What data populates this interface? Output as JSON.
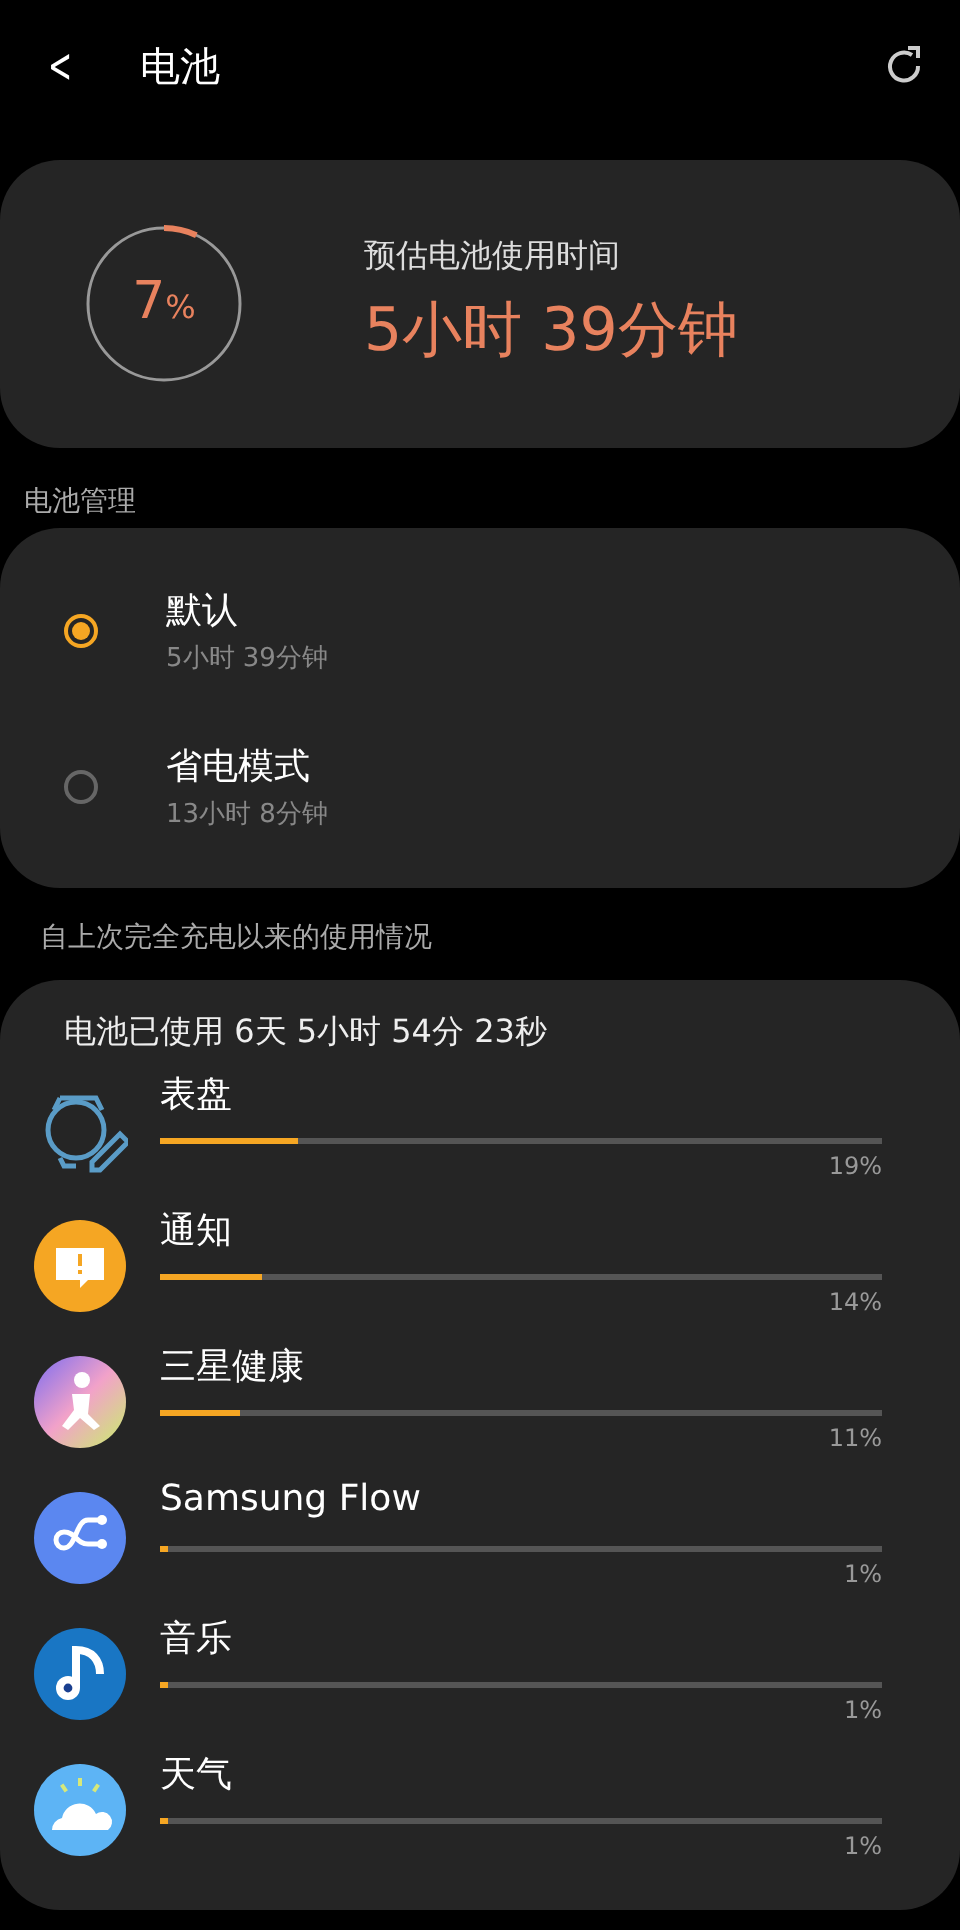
{
  "header": {
    "back": "<",
    "title": "电池"
  },
  "summary": {
    "percent": "7",
    "percent_sign": "%",
    "level": 0.07,
    "label": "预估电池使用时间",
    "estimate": "5小时 39分钟"
  },
  "management": {
    "heading": "电池管理",
    "modes": [
      {
        "name": "默认",
        "time": "5小时 39分钟",
        "selected": true
      },
      {
        "name": "省电模式",
        "time": "13小时 8分钟",
        "selected": false
      }
    ]
  },
  "usage": {
    "heading": "自上次完全充电以来的使用情况",
    "total": "电池已使用 6天 5小时 54分 23秒",
    "apps": [
      {
        "kind": "watchface",
        "name": "表盘",
        "level": 0.19,
        "percent": "19%"
      },
      {
        "kind": "notification",
        "name": "通知",
        "level": 0.14,
        "percent": "14%"
      },
      {
        "kind": "health",
        "name": "三星健康",
        "level": 0.11,
        "percent": "11%"
      },
      {
        "kind": "flow",
        "name": "Samsung Flow",
        "level": 0.01,
        "percent": "1%"
      },
      {
        "kind": "music",
        "name": "音乐",
        "level": 0.01,
        "percent": "1%"
      },
      {
        "kind": "weather",
        "name": "天气",
        "level": 0.01,
        "percent": "1%"
      }
    ]
  }
}
